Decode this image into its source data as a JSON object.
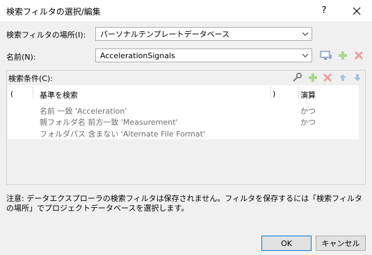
{
  "window": {
    "title": "検索フィルタの選択/編集",
    "help_label": "?",
    "close_label": "✕"
  },
  "location": {
    "label": "検索フィルタの場所(I):",
    "value": "パーソナルテンプレートデータベース"
  },
  "name": {
    "label": "名前(N):",
    "value": "AccelerationSignals"
  },
  "conditions": {
    "label": "検索条件(C):",
    "columns": {
      "open_paren": "(",
      "criteria": "基準を検索",
      "close_paren": ")",
      "operator": "演算"
    },
    "rows": [
      {
        "criteria": "名前 一致 'Acceleration'",
        "operator": "かつ"
      },
      {
        "criteria": "親フォルダ名 前方一致 'Measurement'",
        "operator": "かつ"
      },
      {
        "criteria": "フォルダパス 含まない 'Alternate File Format'",
        "operator": ""
      }
    ]
  },
  "note": "注意: データエクスプローラの検索フィルタは保存されません。フィルタを保存するには「検索フィルタの場所」でプロジェクトデータベースを選択します。",
  "buttons": {
    "ok": "OK",
    "cancel": "キャンセル"
  },
  "colors": {
    "add_green": "#6cbb3c",
    "delete_red": "#e06060",
    "arrow_blue": "#5b8fd6",
    "ok_border": "#0078d7"
  }
}
